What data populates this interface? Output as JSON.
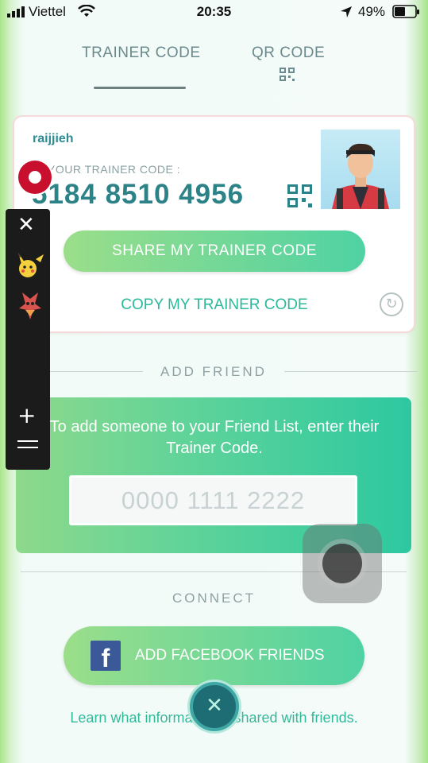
{
  "status_bar": {
    "carrier": "Viettel",
    "time": "20:35",
    "battery": "49%"
  },
  "tabs": [
    {
      "label": "TRAINER CODE",
      "active": true
    },
    {
      "label": "QR CODE",
      "active": false
    }
  ],
  "trainer": {
    "username": "raijjieh",
    "code_label": "YOUR TRAINER CODE :",
    "code": "5184 8510 4956",
    "share_label": "SHARE MY TRAINER CODE",
    "copy_label": "COPY MY TRAINER CODE"
  },
  "add_friend": {
    "title": "ADD FRIEND",
    "instructions": "To add someone to your Friend List, enter their Trainer Code.",
    "input_placeholder": "0000 1111 2222"
  },
  "connect": {
    "title": "CONNECT",
    "facebook_label": "ADD FACEBOOK FRIENDS",
    "learn_text": "Learn what information is shared with friends."
  },
  "colors": {
    "accent_teal": "#2b8287",
    "button_green": "#4fd2a3",
    "facebook_blue": "#3b5998"
  },
  "icons": {
    "qr": "qr-code-icon",
    "refresh": "refresh-icon",
    "close": "close-icon"
  }
}
